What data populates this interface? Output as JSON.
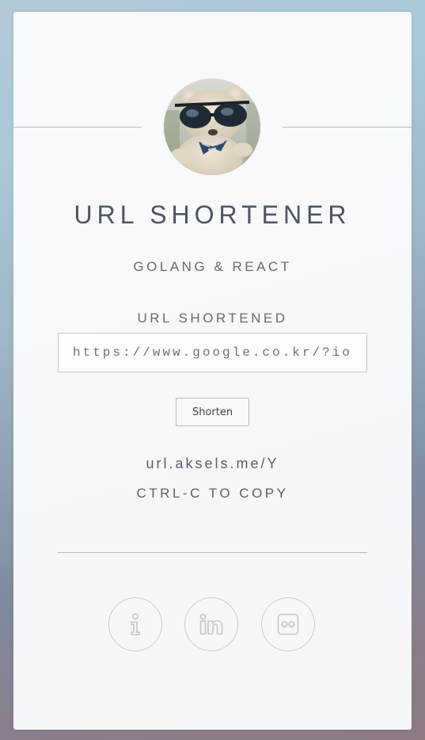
{
  "header": {
    "title": "URL SHORTENER",
    "subtitle": "GOLANG & REACT"
  },
  "avatar": {
    "icon": "teddy-bear-sunglasses-photo"
  },
  "form": {
    "label": "URL SHORTENED",
    "input_value": "https://www.google.co.kr/?ion=",
    "button_label": "Shorten"
  },
  "result": {
    "short_url": "url.aksels.me/Y",
    "hint": "CTRL-C TO COPY"
  },
  "social_links": [
    {
      "icon": "info-icon"
    },
    {
      "icon": "linkedin-icon"
    },
    {
      "icon": "flickr-icon"
    }
  ],
  "colors": {
    "card_background": "#fafbfc",
    "text_primary": "#4c5560",
    "text_secondary": "#636a72",
    "border": "#c4c8cc",
    "icon_stroke": "#c2c6ca"
  }
}
